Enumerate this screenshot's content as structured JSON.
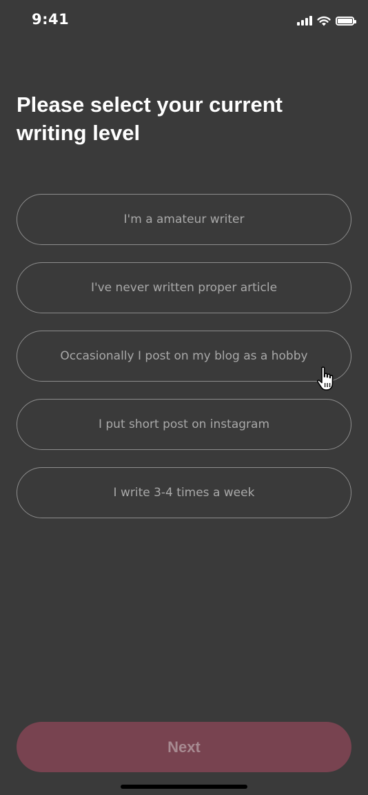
{
  "status_bar": {
    "time": "9:41",
    "icons": [
      "signal-icon",
      "wifi-icon",
      "battery-icon"
    ]
  },
  "title": "Please select your current writing level",
  "options": [
    {
      "label": "I'm a amateur writer"
    },
    {
      "label": "I've never written proper article"
    },
    {
      "label": "Occasionally I post on my blog as a hobby"
    },
    {
      "label": "I put short post on instagram"
    },
    {
      "label": "I write 3-4 times a week"
    }
  ],
  "next_button": {
    "label": "Next"
  },
  "colors": {
    "background": "#3a3a3a",
    "option_border": "#8e8e8e",
    "option_text": "#a9a9a9",
    "next_button_bg": "#784350",
    "next_button_text": "#a78a91"
  }
}
